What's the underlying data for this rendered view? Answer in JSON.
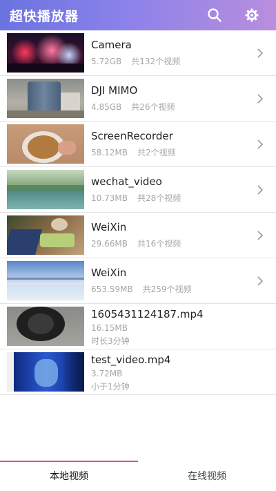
{
  "app": {
    "title": "超快播放器"
  },
  "header": {
    "search_icon": "search-icon",
    "settings_icon": "settings-gear-icon"
  },
  "folders": [
    {
      "name": "Camera",
      "size": "5.72GB",
      "count": "共132个视频"
    },
    {
      "name": "DJI MIMO",
      "size": "4.85GB",
      "count": "共26个视频"
    },
    {
      "name": "ScreenRecorder",
      "size": "58.12MB",
      "count": "共2个视频"
    },
    {
      "name": "wechat_video",
      "size": "10.73MB",
      "count": "共28个视频"
    },
    {
      "name": "WeiXin",
      "size": "29.66MB",
      "count": "共16个视频"
    },
    {
      "name": "WeiXin",
      "size": "653.59MB",
      "count": "共259个视频"
    }
  ],
  "files": [
    {
      "name": "1605431124187.mp4",
      "size": "16.15MB",
      "duration": "时长3分钟"
    },
    {
      "name": "test_video.mp4",
      "size": "3.72MB",
      "duration": "小于1分钟"
    }
  ],
  "tabs": {
    "local": "本地视频",
    "online": "在线视频",
    "active": "local"
  },
  "colors": {
    "appbar_start": "#6b73e0",
    "appbar_end": "#b98ede",
    "tab_indicator": "#d7577a"
  }
}
